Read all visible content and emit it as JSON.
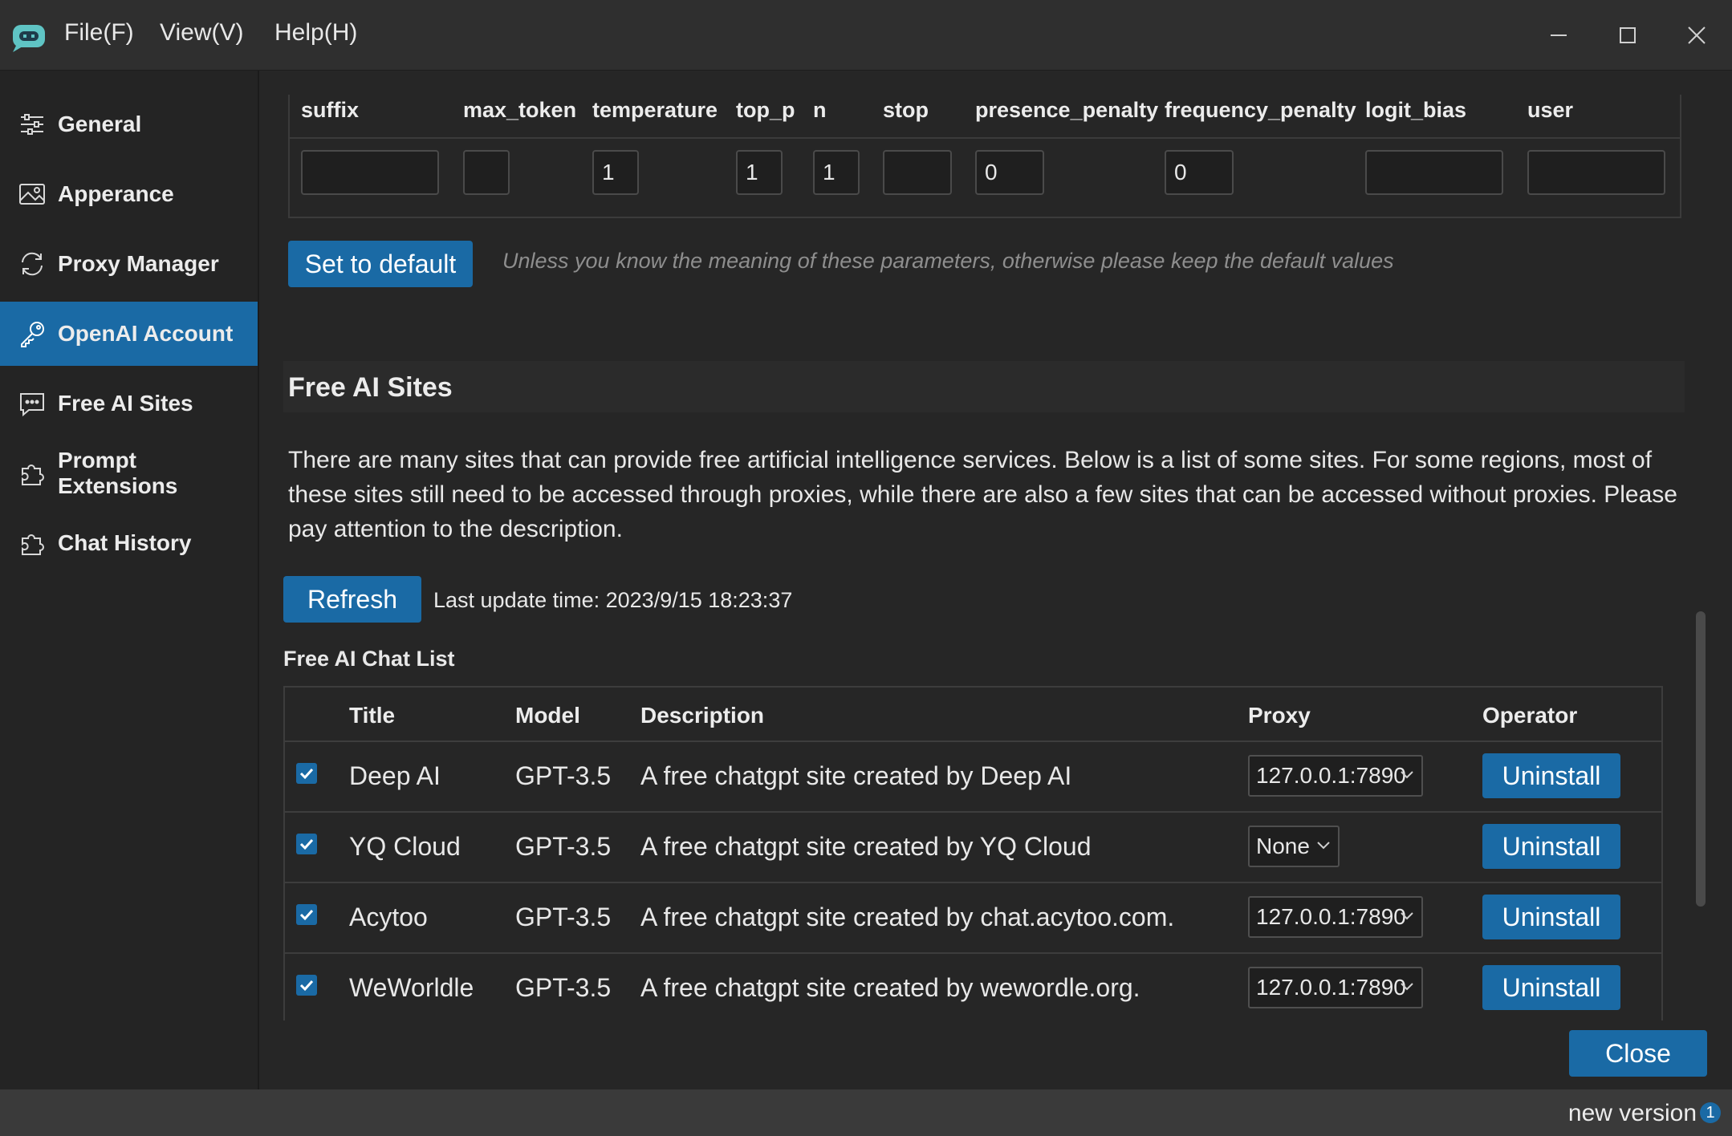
{
  "menu": {
    "file": "File(F)",
    "view": "View(V)",
    "help": "Help(H)"
  },
  "sidebar": {
    "items": [
      {
        "label": "General",
        "icon": "sliders-icon"
      },
      {
        "label": "Apperance",
        "icon": "image-icon"
      },
      {
        "label": "Proxy Manager",
        "icon": "refresh-icon"
      },
      {
        "label": "OpenAI Account",
        "icon": "key-icon",
        "active": true
      },
      {
        "label": "Free AI Sites",
        "icon": "chat-bubble-icon"
      },
      {
        "label": "Prompt Extensions",
        "icon": "puzzle-icon"
      },
      {
        "label": "Chat History",
        "icon": "puzzle-icon"
      }
    ]
  },
  "params": {
    "headers": [
      "suffix",
      "max_token",
      "temperature",
      "top_p",
      "n",
      "stop",
      "presence_penalty",
      "frequency_penalty",
      "logit_bias",
      "user"
    ],
    "values": [
      "",
      "",
      "1",
      "1",
      "1",
      "",
      "0",
      "0",
      "",
      ""
    ],
    "set_default_label": "Set to default",
    "hint": "Unless you know the meaning of these parameters, otherwise please keep the default values"
  },
  "free_sites": {
    "title": "Free AI Sites",
    "description": "There are many sites that can provide free artificial intelligence services. Below is a list of some sites. For some regions, most of these sites still need to be accessed through proxies, while there are also a few sites that can be accessed without proxies. Please pay attention to the description.",
    "refresh_label": "Refresh",
    "last_update": "Last update time: 2023/9/15 18:23:37",
    "list_title": "Free AI Chat List",
    "columns": {
      "title": "Title",
      "model": "Model",
      "description": "Description",
      "proxy": "Proxy",
      "operator": "Operator"
    },
    "rows": [
      {
        "checked": true,
        "title": "Deep AI",
        "model": "GPT-3.5",
        "description": "A free chatgpt site created by Deep AI",
        "proxy": "127.0.0.1:7890",
        "action": "Uninstall"
      },
      {
        "checked": true,
        "title": "YQ Cloud",
        "model": "GPT-3.5",
        "description": "A free chatgpt site created by YQ Cloud",
        "proxy": "None",
        "action": "Uninstall"
      },
      {
        "checked": true,
        "title": "Acytoo",
        "model": "GPT-3.5",
        "description": "A free chatgpt site created by chat.acytoo.com.",
        "proxy": "127.0.0.1:7890",
        "action": "Uninstall"
      },
      {
        "checked": true,
        "title": "WeWorldle",
        "model": "GPT-3.5",
        "description": "A free chatgpt site created by wewordle.org.",
        "proxy": "127.0.0.1:7890",
        "action": "Uninstall"
      }
    ]
  },
  "footer": {
    "close_label": "Close"
  },
  "status": {
    "new_version": "new version",
    "badge": "1"
  },
  "colors": {
    "accent": "#1a6aa5",
    "background": "#262626",
    "sidebar": "#242424",
    "titlebar": "#2f2f2f",
    "statusbar": "#3a3a3a"
  }
}
